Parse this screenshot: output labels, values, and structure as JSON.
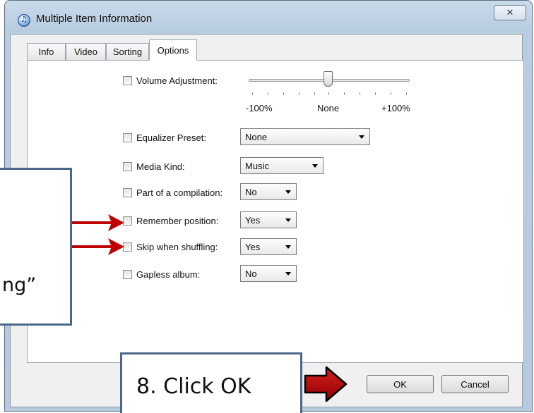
{
  "window": {
    "title": "Multiple Item Information",
    "close_glyph": "✕"
  },
  "tabs": [
    {
      "label": "Info",
      "active": false
    },
    {
      "label": "Video",
      "active": false
    },
    {
      "label": "Sorting",
      "active": false
    },
    {
      "label": "Options",
      "active": true
    }
  ],
  "options": {
    "volume": {
      "label": "Volume Adjustment:",
      "value_percent": 0,
      "scale": {
        "min": "-100%",
        "mid": "None",
        "max": "+100%"
      }
    },
    "equalizer": {
      "label": "Equalizer Preset:",
      "value": "None"
    },
    "media_kind": {
      "label": "Media Kind:",
      "value": "Music"
    },
    "compilation": {
      "label": "Part of a compilation:",
      "value": "No"
    },
    "remember": {
      "label": "Remember position:",
      "value": "Yes"
    },
    "skip": {
      "label": "Skip when shuffling:",
      "value": "Yes"
    },
    "gapless": {
      "label": "Gapless album:",
      "value": "No"
    }
  },
  "buttons": {
    "ok": "OK",
    "cancel": "Cancel"
  },
  "annotations": {
    "left_box_fragment": "ng”",
    "step_text": "8.  Click OK",
    "arrow_color": "#c00000"
  }
}
